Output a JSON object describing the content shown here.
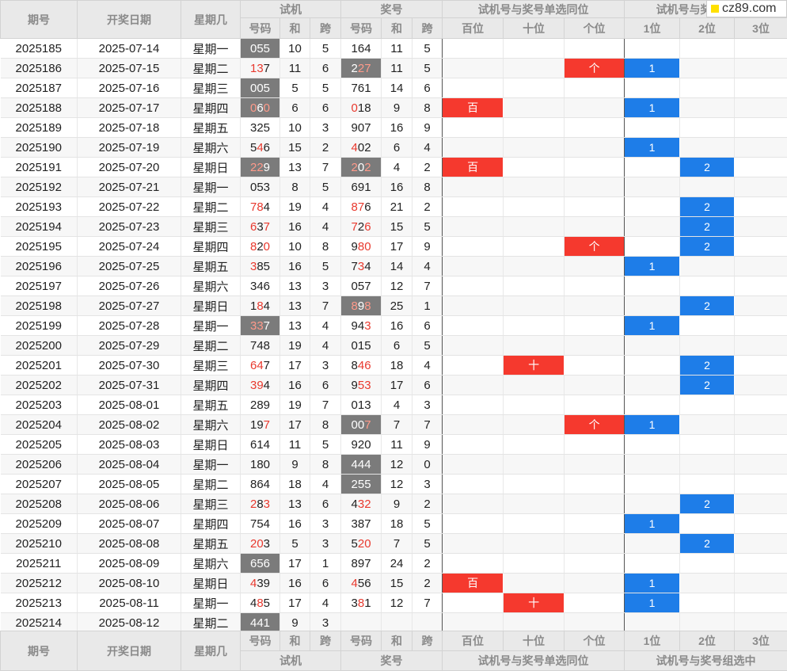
{
  "header": {
    "qihao": "期号",
    "date": "开奖日期",
    "weekday": "星期几",
    "trial": "试机",
    "prize": "奖号",
    "single_pos": "试机号与奖号单选同位",
    "group_pos": "试机号与奖号组选中",
    "sub_code": "号码",
    "sub_sum": "和",
    "sub_span": "跨",
    "pos_hundred": "百位",
    "pos_ten": "十位",
    "pos_one": "个位",
    "g1": "1位",
    "g2": "2位",
    "g3": "3位"
  },
  "logo_text": "cz89.com",
  "rows": [
    {
      "issue": "2025185",
      "date": "2025-07-14",
      "weekday": "星期一",
      "trial": "055",
      "trial_red": [],
      "trial_hl": true,
      "tsum": "10",
      "tspan": "5",
      "prize": "164",
      "prize_red": [],
      "prize_hl": false,
      "psum": "11",
      "pspan": "5",
      "single": {},
      "group": {}
    },
    {
      "issue": "2025186",
      "date": "2025-07-15",
      "weekday": "星期二",
      "trial": "137",
      "trial_red": [
        0,
        1
      ],
      "trial_hl": false,
      "tsum": "11",
      "tspan": "6",
      "prize": "227",
      "prize_red": [
        1,
        2
      ],
      "prize_hl": true,
      "psum": "11",
      "pspan": "5",
      "single": {
        "ge": "个"
      },
      "group": {
        "g1": "1"
      }
    },
    {
      "issue": "2025187",
      "date": "2025-07-16",
      "weekday": "星期三",
      "trial": "005",
      "trial_red": [],
      "trial_hl": true,
      "tsum": "5",
      "tspan": "5",
      "prize": "761",
      "prize_red": [],
      "prize_hl": false,
      "psum": "14",
      "pspan": "6",
      "single": {},
      "group": {}
    },
    {
      "issue": "2025188",
      "date": "2025-07-17",
      "weekday": "星期四",
      "trial": "060",
      "trial_red": [
        0,
        2
      ],
      "trial_hl": true,
      "tsum": "6",
      "tspan": "6",
      "prize": "018",
      "prize_red": [
        0
      ],
      "prize_hl": false,
      "psum": "9",
      "pspan": "8",
      "single": {
        "bai": "百"
      },
      "group": {
        "g1": "1"
      }
    },
    {
      "issue": "2025189",
      "date": "2025-07-18",
      "weekday": "星期五",
      "trial": "325",
      "trial_red": [],
      "trial_hl": false,
      "tsum": "10",
      "tspan": "3",
      "prize": "907",
      "prize_red": [],
      "prize_hl": false,
      "psum": "16",
      "pspan": "9",
      "single": {},
      "group": {}
    },
    {
      "issue": "2025190",
      "date": "2025-07-19",
      "weekday": "星期六",
      "trial": "546",
      "trial_red": [
        1
      ],
      "trial_hl": false,
      "tsum": "15",
      "tspan": "2",
      "prize": "402",
      "prize_red": [
        0
      ],
      "prize_hl": false,
      "psum": "6",
      "pspan": "4",
      "single": {},
      "group": {
        "g1": "1"
      }
    },
    {
      "issue": "2025191",
      "date": "2025-07-20",
      "weekday": "星期日",
      "trial": "229",
      "trial_red": [
        0,
        1
      ],
      "trial_hl": true,
      "tsum": "13",
      "tspan": "7",
      "prize": "202",
      "prize_red": [
        0,
        2
      ],
      "prize_hl": true,
      "psum": "4",
      "pspan": "2",
      "single": {
        "bai": "百"
      },
      "group": {
        "g2": "2"
      }
    },
    {
      "issue": "2025192",
      "date": "2025-07-21",
      "weekday": "星期一",
      "trial": "053",
      "trial_red": [],
      "trial_hl": false,
      "tsum": "8",
      "tspan": "5",
      "prize": "691",
      "prize_red": [],
      "prize_hl": false,
      "psum": "16",
      "pspan": "8",
      "single": {},
      "group": {}
    },
    {
      "issue": "2025193",
      "date": "2025-07-22",
      "weekday": "星期二",
      "trial": "784",
      "trial_red": [
        0,
        1
      ],
      "trial_hl": false,
      "tsum": "19",
      "tspan": "4",
      "prize": "876",
      "prize_red": [
        0,
        1
      ],
      "prize_hl": false,
      "psum": "21",
      "pspan": "2",
      "single": {},
      "group": {
        "g2": "2"
      }
    },
    {
      "issue": "2025194",
      "date": "2025-07-23",
      "weekday": "星期三",
      "trial": "637",
      "trial_red": [
        0,
        2
      ],
      "trial_hl": false,
      "tsum": "16",
      "tspan": "4",
      "prize": "726",
      "prize_red": [
        0,
        2
      ],
      "prize_hl": false,
      "psum": "15",
      "pspan": "5",
      "single": {},
      "group": {
        "g2": "2"
      }
    },
    {
      "issue": "2025195",
      "date": "2025-07-24",
      "weekday": "星期四",
      "trial": "820",
      "trial_red": [
        0,
        2
      ],
      "trial_hl": false,
      "tsum": "10",
      "tspan": "8",
      "prize": "980",
      "prize_red": [
        1,
        2
      ],
      "prize_hl": false,
      "psum": "17",
      "pspan": "9",
      "single": {
        "ge": "个"
      },
      "group": {
        "g2": "2"
      }
    },
    {
      "issue": "2025196",
      "date": "2025-07-25",
      "weekday": "星期五",
      "trial": "385",
      "trial_red": [
        0
      ],
      "trial_hl": false,
      "tsum": "16",
      "tspan": "5",
      "prize": "734",
      "prize_red": [
        1
      ],
      "prize_hl": false,
      "psum": "14",
      "pspan": "4",
      "single": {},
      "group": {
        "g1": "1"
      }
    },
    {
      "issue": "2025197",
      "date": "2025-07-26",
      "weekday": "星期六",
      "trial": "346",
      "trial_red": [],
      "trial_hl": false,
      "tsum": "13",
      "tspan": "3",
      "prize": "057",
      "prize_red": [],
      "prize_hl": false,
      "psum": "12",
      "pspan": "7",
      "single": {},
      "group": {}
    },
    {
      "issue": "2025198",
      "date": "2025-07-27",
      "weekday": "星期日",
      "trial": "184",
      "trial_red": [
        1
      ],
      "trial_hl": false,
      "tsum": "13",
      "tspan": "7",
      "prize": "898",
      "prize_red": [
        0,
        2
      ],
      "prize_hl": true,
      "psum": "25",
      "pspan": "1",
      "single": {},
      "group": {
        "g2": "2"
      }
    },
    {
      "issue": "2025199",
      "date": "2025-07-28",
      "weekday": "星期一",
      "trial": "337",
      "trial_red": [
        0,
        1
      ],
      "trial_hl": true,
      "tsum": "13",
      "tspan": "4",
      "prize": "943",
      "prize_red": [
        2
      ],
      "prize_hl": false,
      "psum": "16",
      "pspan": "6",
      "single": {},
      "group": {
        "g1": "1"
      }
    },
    {
      "issue": "2025200",
      "date": "2025-07-29",
      "weekday": "星期二",
      "trial": "748",
      "trial_red": [],
      "trial_hl": false,
      "tsum": "19",
      "tspan": "4",
      "prize": "015",
      "prize_red": [],
      "prize_hl": false,
      "psum": "6",
      "pspan": "5",
      "single": {},
      "group": {}
    },
    {
      "issue": "2025201",
      "date": "2025-07-30",
      "weekday": "星期三",
      "trial": "647",
      "trial_red": [
        0,
        1
      ],
      "trial_hl": false,
      "tsum": "17",
      "tspan": "3",
      "prize": "846",
      "prize_red": [
        1,
        2
      ],
      "prize_hl": false,
      "psum": "18",
      "pspan": "4",
      "single": {
        "shi": "十"
      },
      "group": {
        "g2": "2"
      }
    },
    {
      "issue": "2025202",
      "date": "2025-07-31",
      "weekday": "星期四",
      "trial": "394",
      "trial_red": [
        0,
        1
      ],
      "trial_hl": false,
      "tsum": "16",
      "tspan": "6",
      "prize": "953",
      "prize_red": [
        1,
        2
      ],
      "prize_hl": false,
      "psum": "17",
      "pspan": "6",
      "single": {},
      "group": {
        "g2": "2"
      }
    },
    {
      "issue": "2025203",
      "date": "2025-08-01",
      "weekday": "星期五",
      "trial": "289",
      "trial_red": [],
      "trial_hl": false,
      "tsum": "19",
      "tspan": "7",
      "prize": "013",
      "prize_red": [],
      "prize_hl": false,
      "psum": "4",
      "pspan": "3",
      "single": {},
      "group": {}
    },
    {
      "issue": "2025204",
      "date": "2025-08-02",
      "weekday": "星期六",
      "trial": "197",
      "trial_red": [
        2
      ],
      "trial_hl": false,
      "tsum": "17",
      "tspan": "8",
      "prize": "007",
      "prize_red": [
        2
      ],
      "prize_hl": true,
      "psum": "7",
      "pspan": "7",
      "single": {
        "ge": "个"
      },
      "group": {
        "g1": "1"
      }
    },
    {
      "issue": "2025205",
      "date": "2025-08-03",
      "weekday": "星期日",
      "trial": "614",
      "trial_red": [],
      "trial_hl": false,
      "tsum": "11",
      "tspan": "5",
      "prize": "920",
      "prize_red": [],
      "prize_hl": false,
      "psum": "11",
      "pspan": "9",
      "single": {},
      "group": {}
    },
    {
      "issue": "2025206",
      "date": "2025-08-04",
      "weekday": "星期一",
      "trial": "180",
      "trial_red": [],
      "trial_hl": false,
      "tsum": "9",
      "tspan": "8",
      "prize": "444",
      "prize_red": [],
      "prize_hl": true,
      "psum": "12",
      "pspan": "0",
      "single": {},
      "group": {}
    },
    {
      "issue": "2025207",
      "date": "2025-08-05",
      "weekday": "星期二",
      "trial": "864",
      "trial_red": [],
      "trial_hl": false,
      "tsum": "18",
      "tspan": "4",
      "prize": "255",
      "prize_red": [],
      "prize_hl": true,
      "psum": "12",
      "pspan": "3",
      "single": {},
      "group": {}
    },
    {
      "issue": "2025208",
      "date": "2025-08-06",
      "weekday": "星期三",
      "trial": "283",
      "trial_red": [
        0,
        2
      ],
      "trial_hl": false,
      "tsum": "13",
      "tspan": "6",
      "prize": "432",
      "prize_red": [
        1,
        2
      ],
      "prize_hl": false,
      "psum": "9",
      "pspan": "2",
      "single": {},
      "group": {
        "g2": "2"
      }
    },
    {
      "issue": "2025209",
      "date": "2025-08-07",
      "weekday": "星期四",
      "trial": "754",
      "trial_red": [],
      "trial_hl": false,
      "tsum": "16",
      "tspan": "3",
      "prize": "387",
      "prize_red": [],
      "prize_hl": false,
      "psum": "18",
      "pspan": "5",
      "single": {},
      "group": {
        "g1": "1"
      }
    },
    {
      "issue": "2025210",
      "date": "2025-08-08",
      "weekday": "星期五",
      "trial": "203",
      "trial_red": [
        0,
        1
      ],
      "trial_hl": false,
      "tsum": "5",
      "tspan": "3",
      "prize": "520",
      "prize_red": [
        1,
        2
      ],
      "prize_hl": false,
      "psum": "7",
      "pspan": "5",
      "single": {},
      "group": {
        "g2": "2"
      }
    },
    {
      "issue": "2025211",
      "date": "2025-08-09",
      "weekday": "星期六",
      "trial": "656",
      "trial_red": [],
      "trial_hl": true,
      "tsum": "17",
      "tspan": "1",
      "prize": "897",
      "prize_red": [],
      "prize_hl": false,
      "psum": "24",
      "pspan": "2",
      "single": {},
      "group": {}
    },
    {
      "issue": "2025212",
      "date": "2025-08-10",
      "weekday": "星期日",
      "trial": "439",
      "trial_red": [
        0
      ],
      "trial_hl": false,
      "tsum": "16",
      "tspan": "6",
      "prize": "456",
      "prize_red": [
        0
      ],
      "prize_hl": false,
      "psum": "15",
      "pspan": "2",
      "single": {
        "bai": "百"
      },
      "group": {
        "g1": "1"
      }
    },
    {
      "issue": "2025213",
      "date": "2025-08-11",
      "weekday": "星期一",
      "trial": "485",
      "trial_red": [
        1
      ],
      "trial_hl": false,
      "tsum": "17",
      "tspan": "4",
      "prize": "381",
      "prize_red": [
        1
      ],
      "prize_hl": false,
      "psum": "12",
      "pspan": "7",
      "single": {
        "shi": "十"
      },
      "group": {
        "g1": "1"
      }
    },
    {
      "issue": "2025214",
      "date": "2025-08-12",
      "weekday": "星期二",
      "trial": "441",
      "trial_red": [],
      "trial_hl": true,
      "tsum": "9",
      "tspan": "3",
      "prize": "",
      "prize_red": [],
      "prize_hl": false,
      "psum": "",
      "pspan": "",
      "single": {},
      "group": {}
    }
  ],
  "colors": {
    "red_mark": "#f5392e",
    "blue_mark": "#1e7de8",
    "highlight_gray": "#7b7b7b",
    "red_digit": "#e8392e"
  }
}
